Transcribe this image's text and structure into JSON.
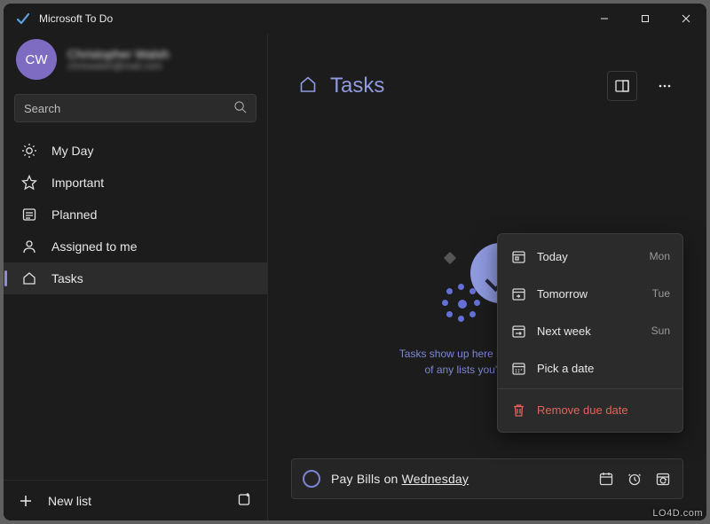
{
  "app": {
    "title": "Microsoft To Do"
  },
  "profile": {
    "initials": "CW",
    "name": "Christopher Walsh",
    "email": "chriswalsh@mail.com"
  },
  "search": {
    "placeholder": "Search"
  },
  "sidebar": {
    "items": [
      {
        "label": "My Day",
        "icon": "sun-icon"
      },
      {
        "label": "Important",
        "icon": "star-icon"
      },
      {
        "label": "Planned",
        "icon": "calendar-icon"
      },
      {
        "label": "Assigned to me",
        "icon": "person-icon"
      },
      {
        "label": "Tasks",
        "icon": "home-icon",
        "selected": true
      }
    ],
    "new_list_label": "New list"
  },
  "main": {
    "title": "Tasks",
    "empty_line1": "Tasks show up here if they aren't part",
    "empty_line2": "of any lists you've created."
  },
  "popup": {
    "items": [
      {
        "label": "Today",
        "day": "Mon"
      },
      {
        "label": "Tomorrow",
        "day": "Tue"
      },
      {
        "label": "Next week",
        "day": "Sun"
      },
      {
        "label": "Pick a date"
      }
    ],
    "remove_label": "Remove due date"
  },
  "task_input": {
    "prefix": "Pay Bills on ",
    "day": "Wednesday"
  },
  "watermark": "LO4D.com"
}
